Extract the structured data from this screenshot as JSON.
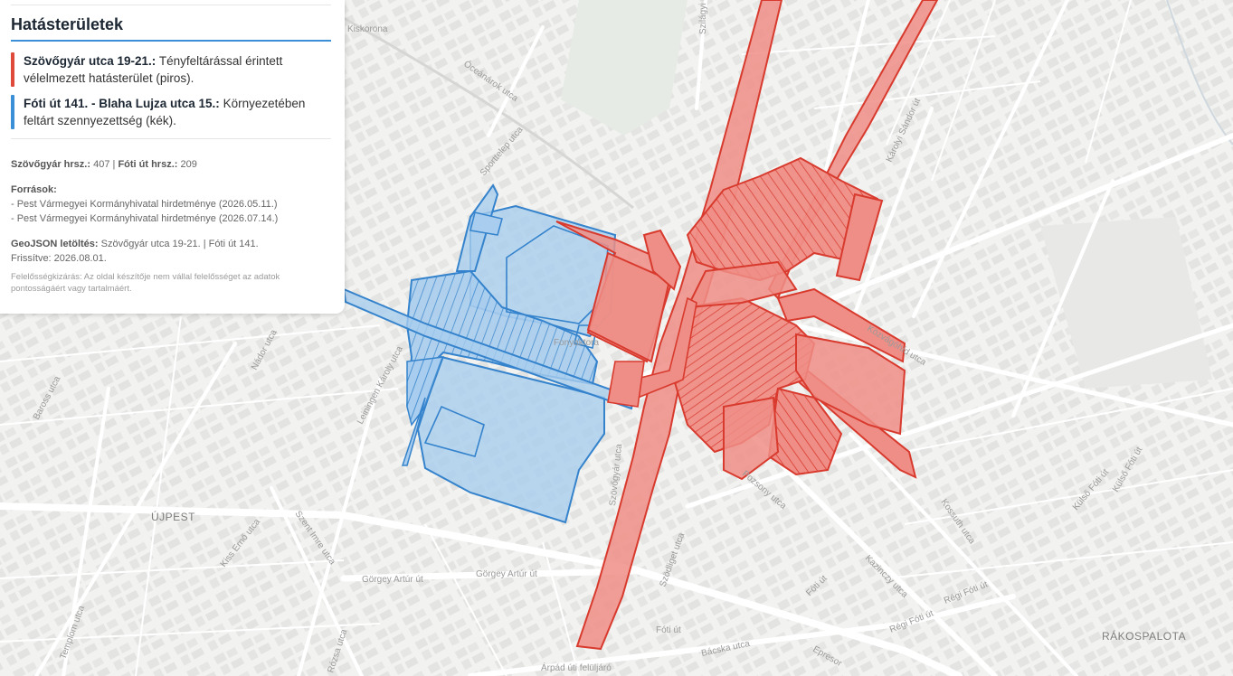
{
  "panel": {
    "title": "Hatásterületek",
    "legend": [
      {
        "name": "Szövőgyár utca 19-21.:",
        "desc": "Tényfeltárással érintett vélelmezett hatásterület (piros).",
        "color": "#e04a3a"
      },
      {
        "name": "Fóti út 141. - Blaha Lujza utca 15.:",
        "desc": "Környezetében feltárt szennyezettség (kék).",
        "color": "#3a8fd6"
      }
    ],
    "hrsz_label_1": "Szövőgyár hrsz.:",
    "hrsz_value_1": "407",
    "hrsz_sep": "|",
    "hrsz_label_2": "Fóti út hrsz.:",
    "hrsz_value_2": "209",
    "sources_label": "Források:",
    "sources": [
      "- Pest Vármegyei Kormányhivatal hirdetménye (2026.05.11.)",
      "- Pest Vármegyei Kormányhivatal hirdetménye (2026.07.14.)"
    ],
    "geojson_label": "GeoJSON letöltés:",
    "geojson_links": "Szövőgyár utca 19-21. | Fóti út 141.",
    "updated": "Frissítve: 2026.08.01.",
    "disclaimer": "Felelősségkizárás: Az oldal készítője nem vállal felelősséget az adatok pontosságáért vagy tartalmáért."
  },
  "map": {
    "districts": [
      "ÚJPEST",
      "RÁKOSPALOTA"
    ],
    "streets": [
      "Nádor utca",
      "Baross utca",
      "Leiningen Károly utca",
      "Szent Imre utca",
      "Kiss Ernő utca",
      "Templom utca",
      "Rózsa utca",
      "Görgey Artúr út",
      "Árpád úti felüljáró",
      "Fóti út",
      "Szödliget utca",
      "Kazinczy utca",
      "Régi Fóti út",
      "Bácska utca",
      "Epresor",
      "Pozsony utca",
      "Kossuth utca",
      "Külső Fóti út",
      "Közvágóhíd utca",
      "Károlyi Sándor út",
      "Óceánárok utca",
      "Sporttelep utca",
      "Szilágyi utca",
      "Kiskorona",
      "Szövőgyár utca",
      "Fonyaktora"
    ],
    "colors": {
      "red_fill": "#ef8e86",
      "red_stroke": "#d93a2e",
      "blue_fill": "#a9cdee",
      "blue_stroke": "#3483cc"
    }
  }
}
